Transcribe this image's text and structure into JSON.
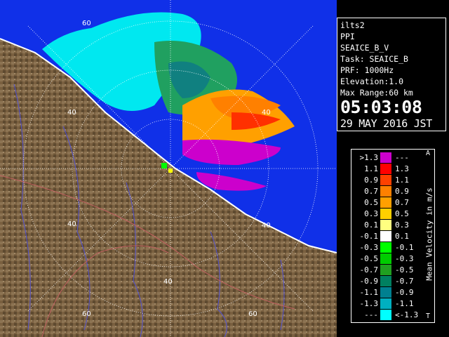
{
  "info": {
    "site": "ilts2",
    "mode": "PPI",
    "product": "SEAICE_B_V",
    "task": "Task: SEAICE_B",
    "prf": "PRF: 1000Hz",
    "elevation": "Elevation:1.0",
    "max_range": "Max Range:60 km",
    "time": "05:03:08",
    "date": "29 MAY 2016 JST"
  },
  "ring_labels": {
    "top": "60",
    "west_inner": "40",
    "north_east": "40",
    "south_west": "40",
    "south": "40",
    "south_east": "40",
    "south_outer_left": "60",
    "south_outer_right": "60"
  },
  "legend": {
    "title": "Mean Velocity in m/s",
    "top_marker": "A",
    "bottom_marker": "T",
    "rows": [
      {
        "left": ">1.3",
        "right": "---",
        "color": "#cc00cc"
      },
      {
        "left": "1.1",
        "right": "1.3",
        "color": "#ff0000"
      },
      {
        "left": "0.9",
        "right": "1.1",
        "color": "#ff4000"
      },
      {
        "left": "0.7",
        "right": "0.9",
        "color": "#ff8000"
      },
      {
        "left": "0.5",
        "right": "0.7",
        "color": "#ffa000"
      },
      {
        "left": "0.3",
        "right": "0.5",
        "color": "#ffd000"
      },
      {
        "left": "0.1",
        "right": "0.3",
        "color": "#ffff80"
      },
      {
        "left": "-0.1",
        "right": "0.1",
        "color": "#ffffff"
      },
      {
        "left": "-0.3",
        "right": "-0.1",
        "color": "#00ff00"
      },
      {
        "left": "-0.5",
        "right": "-0.3",
        "color": "#00cc00"
      },
      {
        "left": "-0.7",
        "right": "-0.5",
        "color": "#20a020"
      },
      {
        "left": "-0.9",
        "right": "-0.7",
        "color": "#008060"
      },
      {
        "left": "-1.1",
        "right": "-0.9",
        "color": "#008090"
      },
      {
        "left": "-1.3",
        "right": "-1.1",
        "color": "#00b0c0"
      },
      {
        "left": "---",
        "right": "<-1.3",
        "color": "#00ffff"
      }
    ]
  },
  "colors": {
    "sea": "#1030e8",
    "land": "#7a6040",
    "ring": "#ffffff"
  }
}
